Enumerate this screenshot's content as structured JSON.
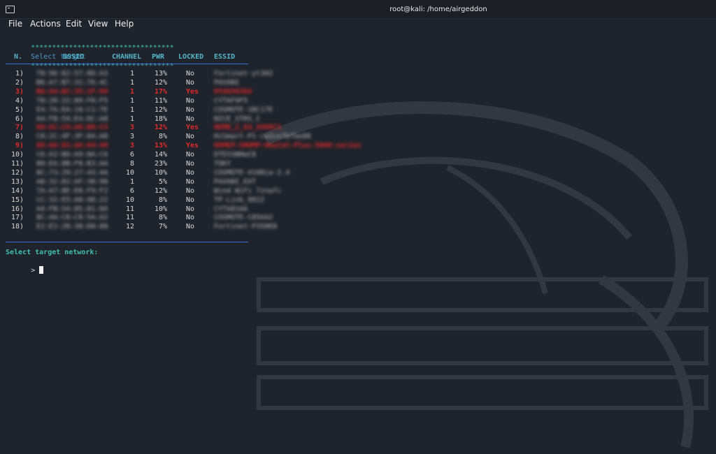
{
  "window": {
    "title": "root@kali: /home/airgeddon",
    "icon": "terminal-icon"
  },
  "menu": {
    "items": [
      {
        "label": "File"
      },
      {
        "label": "Actions"
      },
      {
        "label": "Edit"
      },
      {
        "label": "View"
      },
      {
        "label": "Help"
      }
    ]
  },
  "terminal": {
    "banner_left": "**********************************",
    "banner_title": "Select target",
    "banner_right": "**********************************",
    "headers": {
      "n": "N.",
      "bssid": "BSSID",
      "channel": "CHANNEL",
      "pwr": "PWR",
      "locked": "LOCKED",
      "essid": "ESSID"
    },
    "rows": [
      {
        "n": "1)",
        "bssid": "78:96:82:57:86:A3",
        "channel": "1",
        "pwr": "13%",
        "locked": "No",
        "essid": "Fortinet-yt302"
      },
      {
        "n": "2)",
        "bssid": "B6:A7:B7:31:76:4C",
        "channel": "1",
        "pwr": "12%",
        "locked": "No",
        "essid": "PAVANI"
      },
      {
        "n": "3)",
        "bssid": "B8:A4:BC:35:1F:99",
        "channel": "1",
        "pwr": "17%",
        "locked": "Yes",
        "essid": "HYUG56384"
      },
      {
        "n": "4)",
        "bssid": "78:28:22:89:F0:F5",
        "channel": "1",
        "pwr": "11%",
        "locked": "No",
        "essid": "CYTAF9F5"
      },
      {
        "n": "5)",
        "bssid": "E4:7A:EA:18:C1:7E",
        "channel": "1",
        "pwr": "12%",
        "locked": "No",
        "essid": "COSMOTE-1BC17E"
      },
      {
        "n": "6)",
        "bssid": "A4:FB:54:E4:DC:A8",
        "channel": "1",
        "pwr": "18%",
        "locked": "No",
        "essid": "NICE_STRS_C"
      },
      {
        "n": "7)",
        "bssid": "80:AC:C9:A8:B8:C3",
        "channel": "3",
        "pwr": "12%",
        "locked": "Yes",
        "essid": "NEMB_2_G4_A98DC3"
      },
      {
        "n": "8)",
        "bssid": "C8:2C:4F:3F:84:A8",
        "channel": "3",
        "pwr": "8%",
        "locked": "No",
        "essid": "HiSmart-P1-ca2ce7bfbe88"
      },
      {
        "n": "9)",
        "bssid": "88:A8:82:4A:84:48",
        "channel": "3",
        "pwr": "13%",
        "locked": "Yes",
        "essid": "HOMEP-SMUMP-Hewlet-Plus-5000-series"
      },
      {
        "n": "10)",
        "bssid": "C6:A2:B6:A9:8A:C6",
        "channel": "6",
        "pwr": "14%",
        "locked": "No",
        "essid": "DTESSNHwC8"
      },
      {
        "n": "11)",
        "bssid": "88:EA:8B:F8:B3:AA",
        "channel": "8",
        "pwr": "23%",
        "locked": "No",
        "essid": "TOKY"
      },
      {
        "n": "12)",
        "bssid": "8C:73:29:27:43:4A",
        "channel": "10",
        "pwr": "10%",
        "locked": "No",
        "essid": "COSMOTE-4108ia-2.4"
      },
      {
        "n": "13)",
        "bssid": "A8:32:82:AF:38:98",
        "channel": "1",
        "pwr": "5%",
        "locked": "No",
        "essid": "PAVANI_EXT"
      },
      {
        "n": "14)",
        "bssid": "7A:A7:8E:E8:F9:F2",
        "channel": "6",
        "pwr": "12%",
        "locked": "No",
        "essid": "Wind WiFi 7znafc"
      },
      {
        "n": "15)",
        "bssid": "CC:32:E5:A8:98:22",
        "channel": "10",
        "pwr": "8%",
        "locked": "No",
        "essid": "TP-Link_9022"
      },
      {
        "n": "16)",
        "bssid": "A4:FB:54:85:81:8A",
        "channel": "11",
        "pwr": "10%",
        "locked": "No",
        "essid": "CYTA81AA"
      },
      {
        "n": "17)",
        "bssid": "8C:4A:C8:C8:5A:A2",
        "channel": "11",
        "pwr": "8%",
        "locked": "No",
        "essid": "COSMOTE-C85AA2"
      },
      {
        "n": "18)",
        "bssid": "E2:E2:28:38:D0:88",
        "channel": "12",
        "pwr": "7%",
        "locked": "No",
        "essid": "Fortinet-P350E8"
      }
    ],
    "prompt_label": "Select target network:",
    "prompt_symbol": ">",
    "input_value": ""
  },
  "colors": {
    "background": "#1f232b",
    "banner_stars": "#3fbfae",
    "banner_title": "#4a9cd0",
    "header_text": "#53b5c7",
    "locked_row": "#e02a2a",
    "separator": "#3b6fd8",
    "prompt": "#3fbfae"
  }
}
